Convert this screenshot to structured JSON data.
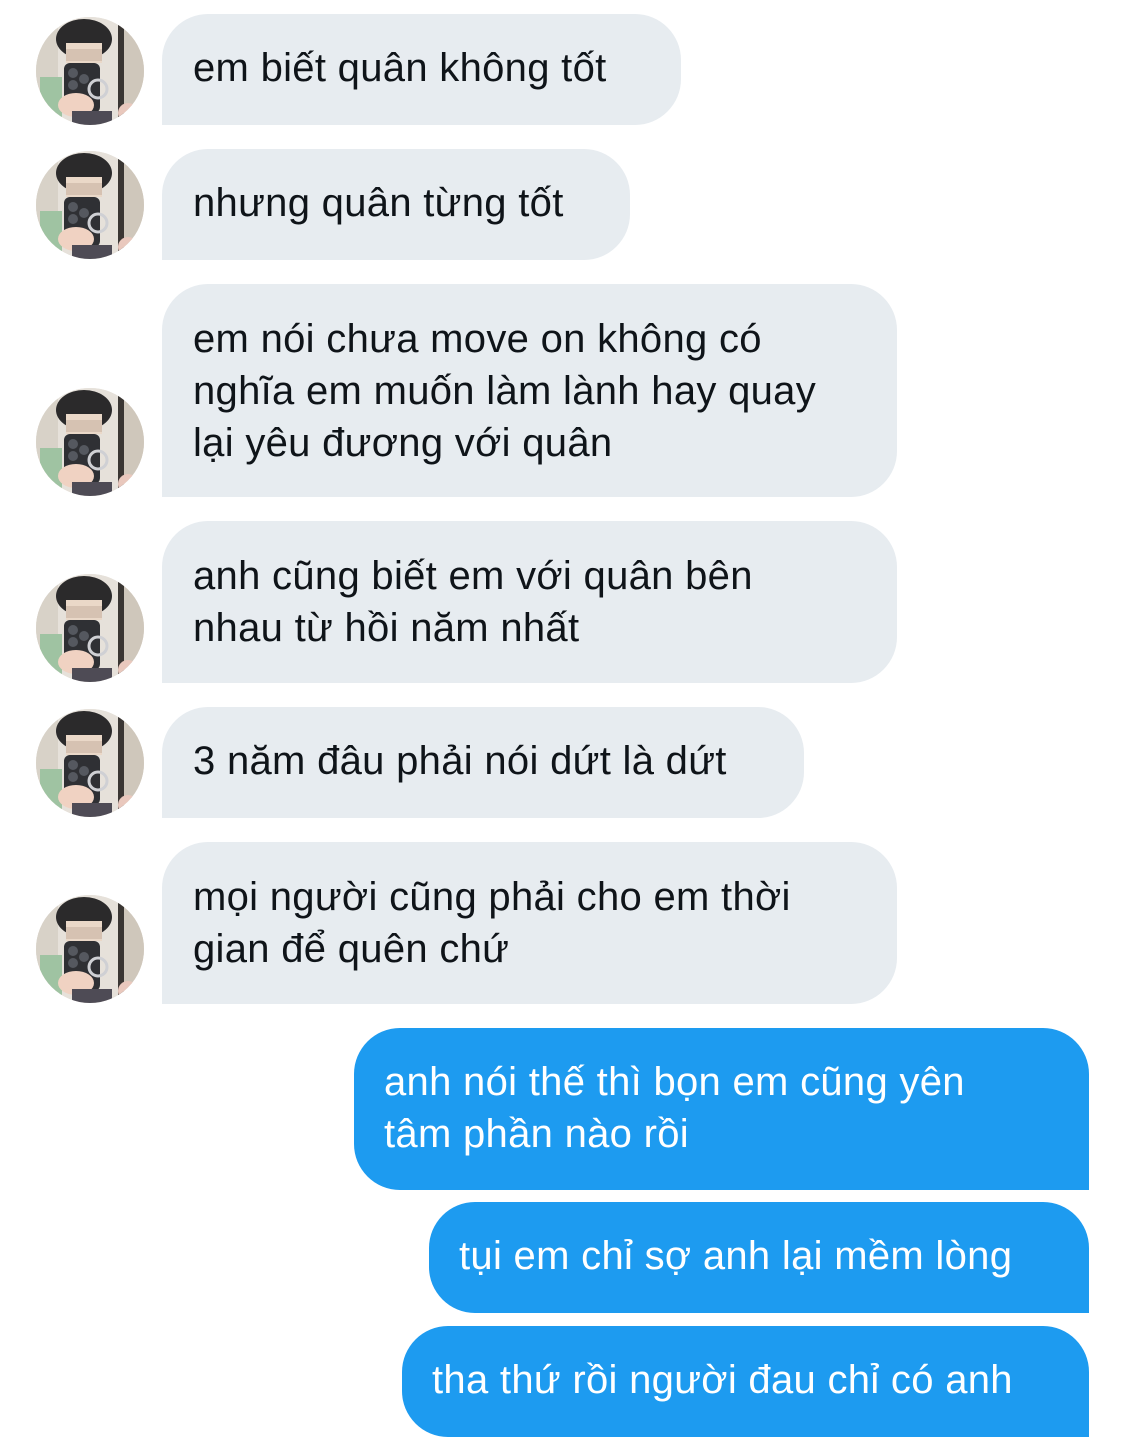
{
  "conversation": {
    "contact_avatar_icon": "profile-photo",
    "colors": {
      "received_bubble": "#e7ecf0",
      "received_text": "#0f1419",
      "sent_bubble": "#1d9bf0",
      "sent_text": "#ffffff"
    },
    "received": [
      "em biết quân không tốt",
      "nhưng quân từng tốt",
      "em nói chưa move on không có\nnghĩa em muốn làm lành hay quay\nlại yêu đương với quân",
      "anh cũng biết em với quân bên\nnhau từ hồi năm nhất",
      "3 năm đâu phải nói dứt là dứt",
      "mọi người cũng phải cho em thời\ngian để quên chứ"
    ],
    "sent": [
      "anh nói thế thì bọn em cũng yên\ntâm phần nào rồi",
      "tụi em chỉ sợ anh lại mềm lòng",
      "tha thứ rồi người đau chỉ có anh"
    ]
  }
}
